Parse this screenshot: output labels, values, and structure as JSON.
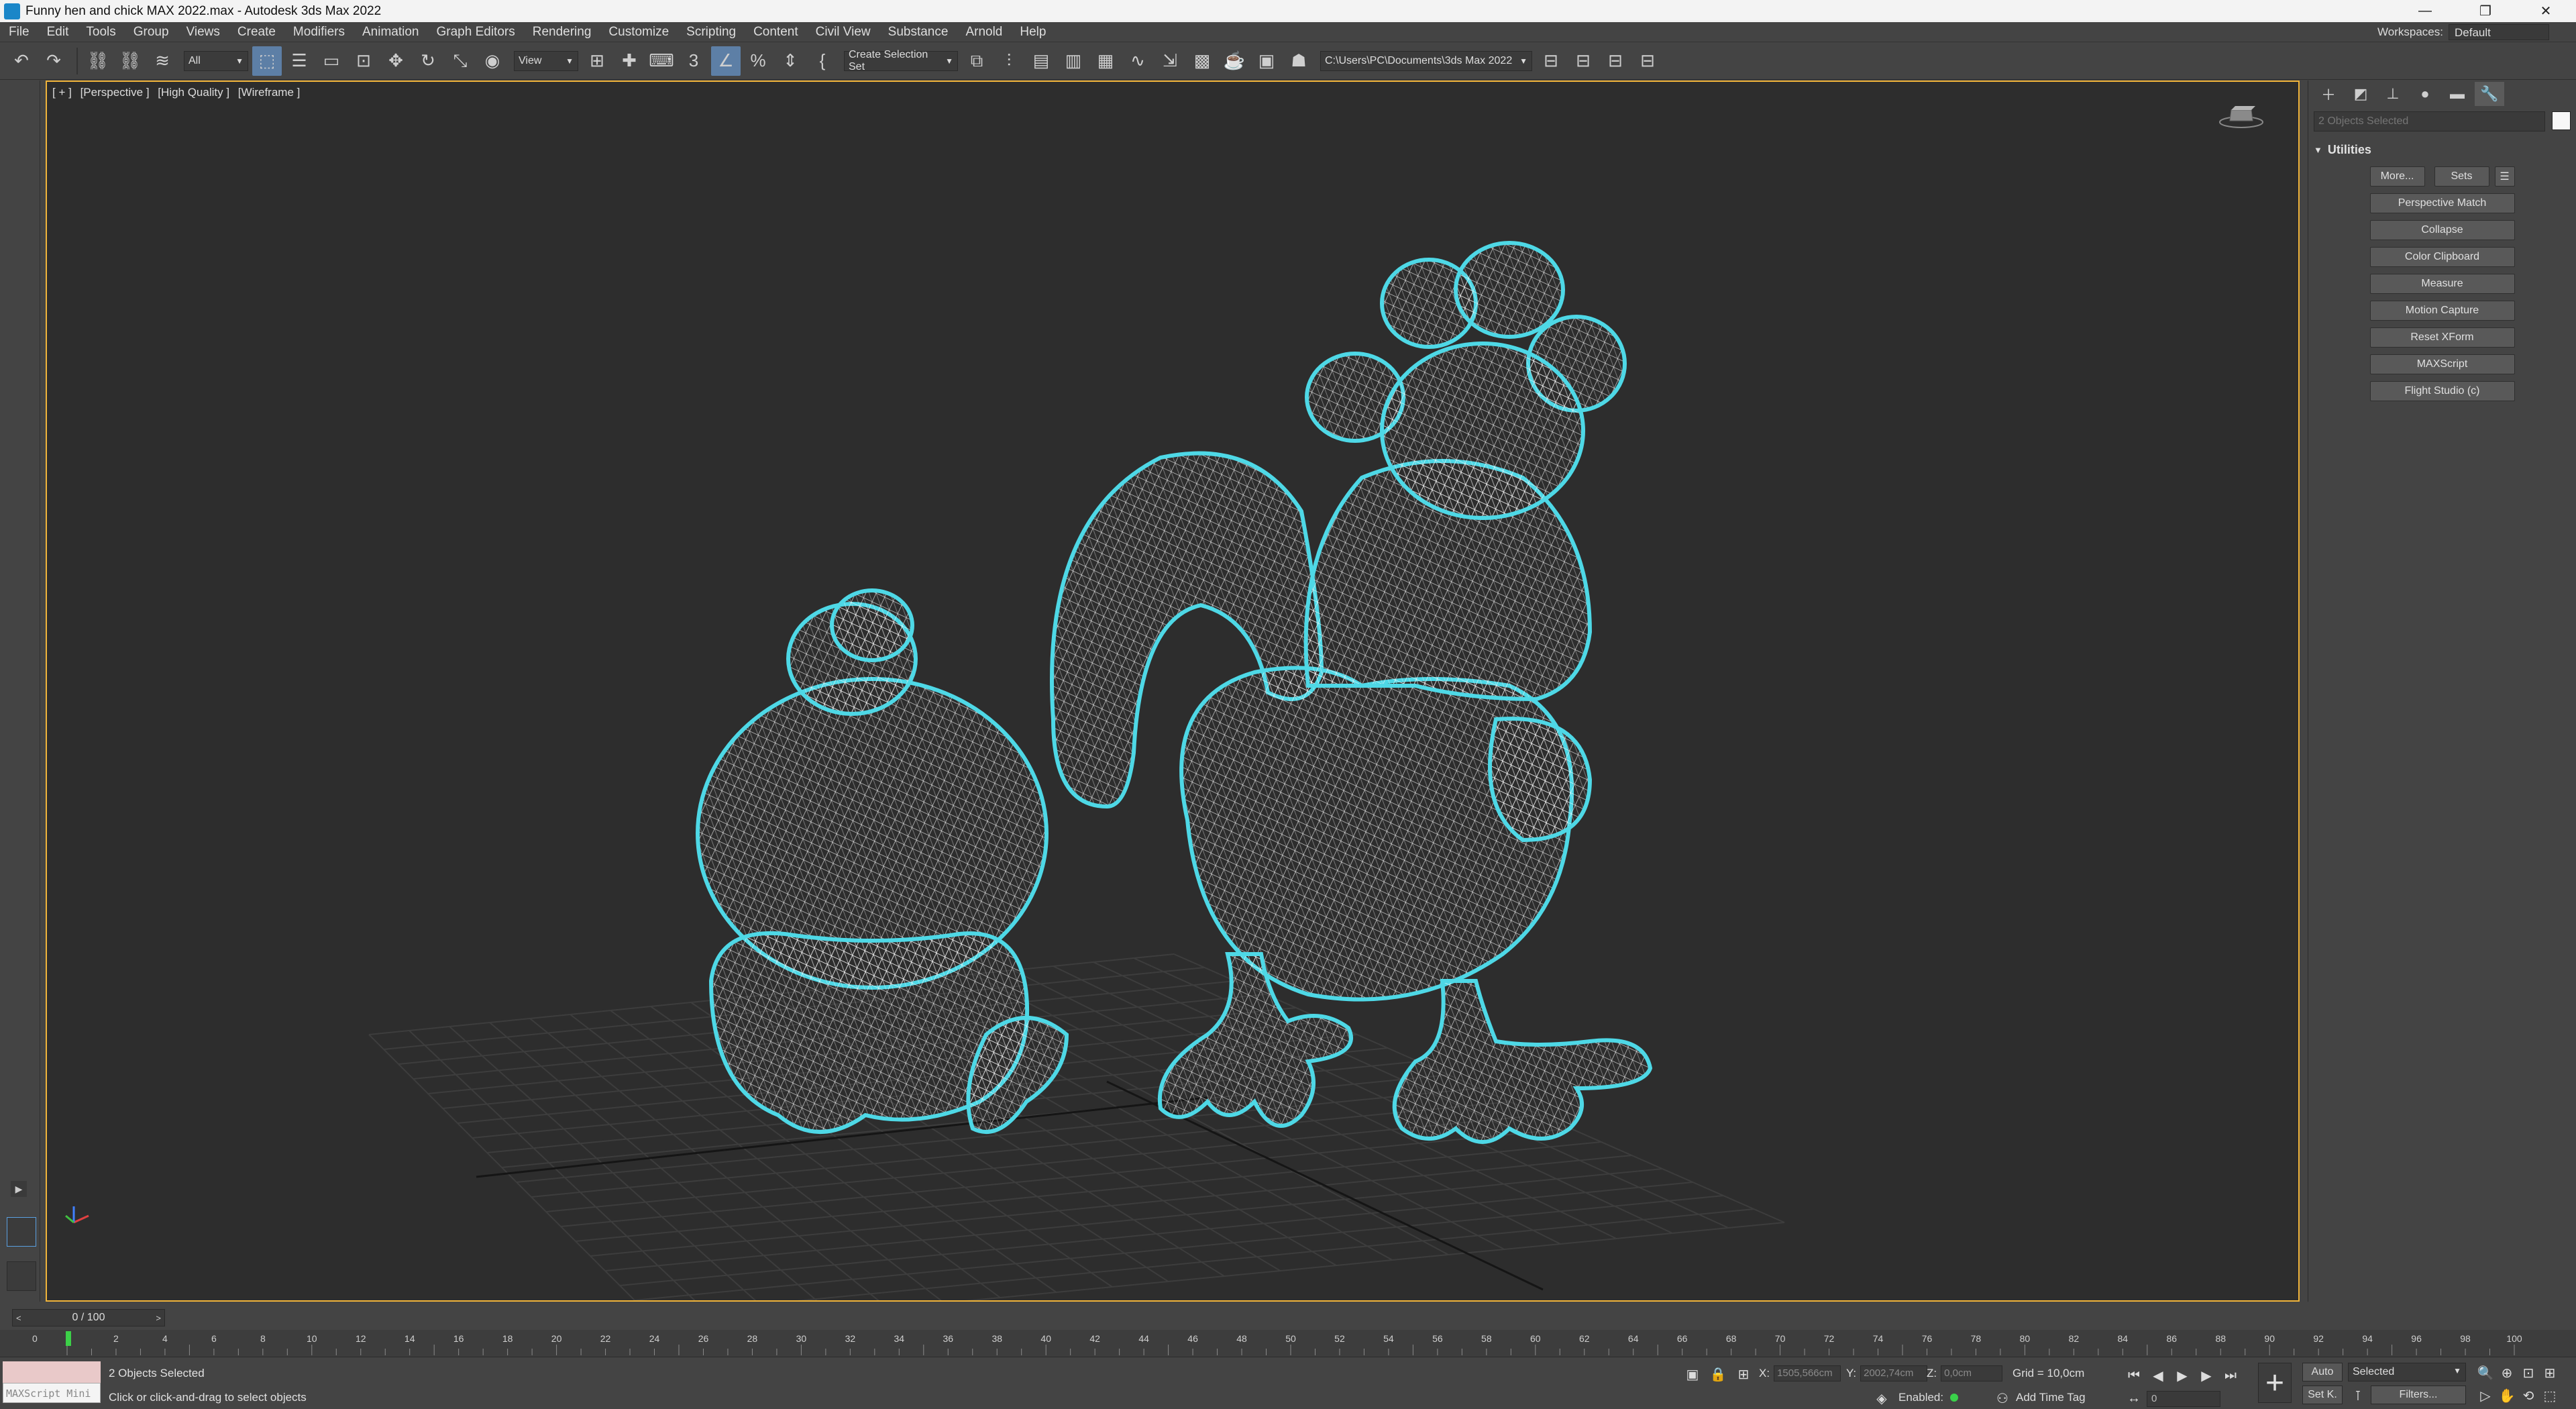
{
  "window": {
    "title": "Funny hen and chick MAX 2022.max - Autodesk 3ds Max 2022",
    "buttons": [
      "—",
      "❐",
      "✕"
    ]
  },
  "menu": {
    "items": [
      "File",
      "Edit",
      "Tools",
      "Group",
      "Views",
      "Create",
      "Modifiers",
      "Animation",
      "Graph Editors",
      "Rendering",
      "Customize",
      "Scripting",
      "Content",
      "Civil View",
      "Substance",
      "Arnold",
      "Help"
    ],
    "workspaces_label": "Workspaces:",
    "workspaces_value": "Default"
  },
  "toolbar": {
    "filter_value": "All",
    "refcoord_value": "View",
    "selection_set_placeholder": "Create Selection Set",
    "project_path": "C:\\Users\\PC\\Documents\\3ds Max 2022"
  },
  "viewport": {
    "labels": [
      "[ + ]",
      "[Perspective ]",
      "[High Quality ]",
      "[Wireframe ]"
    ],
    "wire_color": "#ffffff",
    "selection_outline_color": "#4ed8e6",
    "background_color": "#2d2d2d",
    "active_border_color": "#f0b43a"
  },
  "command_panel": {
    "tabs": [
      "create-icon",
      "modify-icon",
      "hierarchy-icon",
      "motion-icon",
      "display-icon",
      "utilities-icon"
    ],
    "object_name_placeholder": "2 Objects Selected",
    "rollout_title": "Utilities",
    "more_label": "More...",
    "sets_label": "Sets",
    "utilities": [
      "Perspective Match",
      "Collapse",
      "Color Clipboard",
      "Measure",
      "Motion Capture",
      "Reset XForm",
      "MAXScript",
      "Flight Studio (c)"
    ]
  },
  "timeline": {
    "frame_display": "0 / 100",
    "ticks": [
      "2",
      "4",
      "6",
      "8",
      "10",
      "12",
      "14",
      "16",
      "18",
      "20",
      "22",
      "24",
      "26",
      "28",
      "30",
      "32",
      "34",
      "36",
      "38",
      "40",
      "42",
      "44",
      "46",
      "48",
      "50",
      "52",
      "54",
      "56",
      "58",
      "60",
      "62",
      "64",
      "66",
      "68",
      "70",
      "72",
      "74",
      "76",
      "78",
      "80",
      "82",
      "84",
      "86",
      "88",
      "90",
      "92",
      "94",
      "96",
      "98",
      "100"
    ],
    "start_label": "0"
  },
  "status": {
    "maxscript_label": "MAXScript Mini",
    "selected_text": "2 Objects Selected",
    "prompt_text": "Click or click-and-drag to select objects",
    "x_label": "X:",
    "x_value": "1505,566cm",
    "y_label": "Y:",
    "y_value": "2002,74cm",
    "z_label": "Z:",
    "z_value": "0,0cm",
    "grid_text": "Grid = 10,0cm",
    "enabled_label": "Enabled:",
    "add_time_tag": "Add Time Tag",
    "auto_label": "Auto",
    "setk_label": "Set K.",
    "selected_dd": "Selected",
    "filters_label": "Filters...",
    "current_frame": "0"
  }
}
